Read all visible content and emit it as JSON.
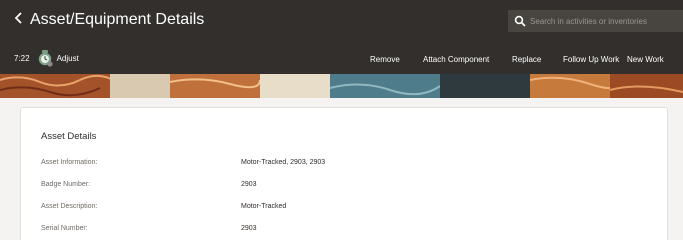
{
  "header": {
    "title": "Asset/Equipment Details",
    "back_icon": "chevron-left-icon",
    "search": {
      "placeholder": "Search in activities or inventories",
      "icon": "search-icon"
    },
    "time": "7:22",
    "adjust_label": "Adjust",
    "adjust_icon": "adjust-clock-icon",
    "actions": [
      "Remove",
      "Attach Component",
      "Replace",
      "Follow Up Work",
      "New Work"
    ]
  },
  "colors": {
    "header_bg": "#322f2c",
    "search_bg": "#48443f",
    "page_bg": "#f4f3f1",
    "card_bg": "#ffffff",
    "banner_accent": "#b5642c"
  },
  "asset_details": {
    "title": "Asset Details",
    "fields": [
      {
        "label": "Asset Information:",
        "value": "Motor-Tracked, 2903, 2903"
      },
      {
        "label": "Badge Number:",
        "value": "2903"
      },
      {
        "label": "Asset Description:",
        "value": "Motor-Tracked"
      },
      {
        "label": "Serial Number:",
        "value": "2903"
      }
    ]
  }
}
